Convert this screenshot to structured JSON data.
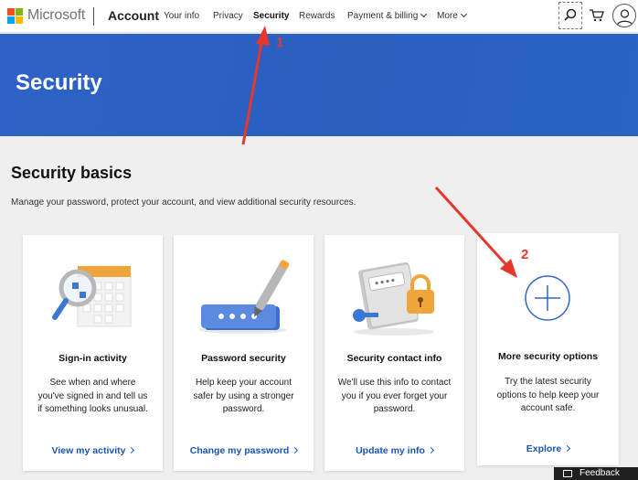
{
  "header": {
    "brand": "Microsoft",
    "account_label": "Account",
    "nav_items": [
      {
        "label": "Your info"
      },
      {
        "label": "Privacy"
      },
      {
        "label": "Security"
      },
      {
        "label": "Rewards"
      },
      {
        "label": "Payment & billing"
      },
      {
        "label": "More"
      }
    ],
    "icons": [
      "search-icon",
      "cart-icon",
      "avatar-icon"
    ]
  },
  "banner": {
    "title": "Security"
  },
  "section": {
    "title": "Security basics",
    "description": "Manage your password, protect your account, and view additional security resources."
  },
  "cards": [
    {
      "title": "Sign-in activity",
      "description": "See when and where you've signed in and tell us if something looks unusual.",
      "link": "View my activity"
    },
    {
      "title": "Password security",
      "description": "Help keep your account safer by using a stronger password.",
      "link": "Change my password"
    },
    {
      "title": "Security contact info",
      "description": "We'll use this info to contact you if you ever forget your password.",
      "link": "Update my info"
    },
    {
      "title": "More security options",
      "description": "Try the latest security options to help keep your account safe.",
      "link": "Explore"
    }
  ],
  "annotations": {
    "num1": "1",
    "num2": "2"
  },
  "feedback": {
    "label": "Feedback"
  },
  "colors": {
    "accent": "#2a5fc0",
    "link": "#1a55b5",
    "annotation": "#e5372a"
  }
}
